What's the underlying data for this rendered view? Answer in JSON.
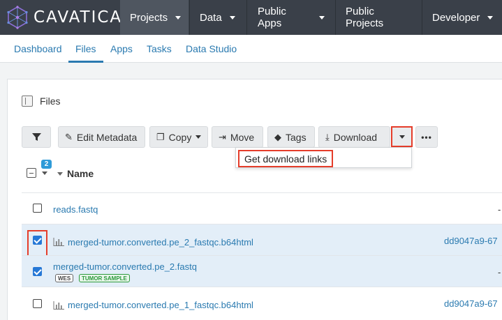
{
  "brand": {
    "name": "CAVATICA"
  },
  "topnav": {
    "items": [
      {
        "label": "Projects"
      },
      {
        "label": "Data"
      },
      {
        "label": "Public Apps"
      },
      {
        "label": "Public Projects"
      },
      {
        "label": "Developer"
      }
    ]
  },
  "subnav": {
    "items": [
      {
        "label": "Dashboard"
      },
      {
        "label": "Files"
      },
      {
        "label": "Apps"
      },
      {
        "label": "Tasks"
      },
      {
        "label": "Data Studio"
      }
    ]
  },
  "panel": {
    "title": "Files"
  },
  "toolbar": {
    "edit_metadata": "Edit Metadata",
    "copy": "Copy",
    "move": "Move",
    "tags": "Tags",
    "download": "Download"
  },
  "download_menu": {
    "get_links": "Get download links"
  },
  "table": {
    "selected_count": "2",
    "name_header": "Name",
    "rows": [
      {
        "name": "reads.fastq",
        "col2": "-"
      },
      {
        "name": "merged-tumor.converted.pe_2_fastqc.b64html",
        "col2": "dd9047a9-67"
      },
      {
        "name": "merged-tumor.converted.pe_2.fastq",
        "col2": "-",
        "tags": [
          "WES",
          "TUMOR SAMPLE"
        ]
      },
      {
        "name": "merged-tumor.converted.pe_1_fastqc.b64html",
        "col2": "dd9047a9-67"
      }
    ]
  },
  "colors": {
    "topnav": "#3a4049",
    "link": "#2a7ab0",
    "highlight": "#e53d2a",
    "selected_row": "#e3eef8",
    "badge": "#2f9bd8"
  }
}
